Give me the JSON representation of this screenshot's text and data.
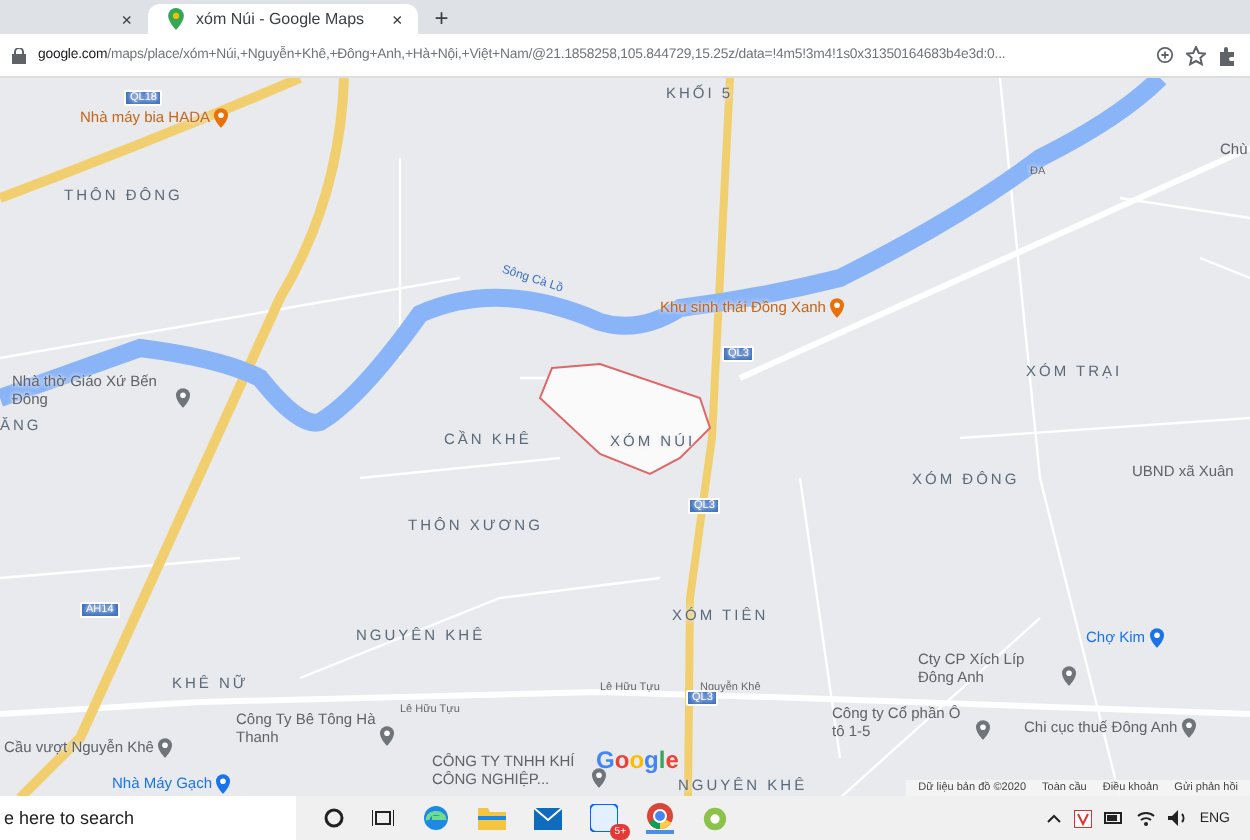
{
  "tabs": [
    {
      "selected": false,
      "close": "×"
    },
    {
      "title": "xóm Núi - Google Maps",
      "selected": true,
      "close": "×"
    }
  ],
  "new_tab": "+",
  "address_bar": {
    "host": "google.com",
    "path": "/maps/place/xóm+Núi,+Nguyễn+Khê,+Đông+Anh,+Hà+Nội,+Việt+Nam/@21.1858258,105.844729,15.25z/data=!4m5!3m4!1s0x31350164683b4e3d:0..."
  },
  "map": {
    "labels": [
      {
        "kind": "shield",
        "text": "QL18"
      },
      {
        "kind": "poi_orange",
        "text": "Nhà máy bia HADA"
      },
      {
        "kind": "locality",
        "text": "KHỐI 5"
      },
      {
        "kind": "locality",
        "text": "THÔN ĐÔNG"
      },
      {
        "kind": "road",
        "text": "ĐA"
      },
      {
        "kind": "place",
        "text": "Chù"
      },
      {
        "kind": "river",
        "text": "Sông Cà Lồ"
      },
      {
        "kind": "poi_orange",
        "text": "Khu sinh thái Đồng Xanh"
      },
      {
        "kind": "shield",
        "text": "QL3"
      },
      {
        "kind": "poi_gray",
        "text": "Nhà thờ Giáo Xứ Bến Đông"
      },
      {
        "kind": "locality",
        "text": "ĂNG"
      },
      {
        "kind": "locality",
        "text": "XÓM TRẠI"
      },
      {
        "kind": "locality",
        "text": "CẦN KHÊ"
      },
      {
        "kind": "locality",
        "text": "XÓM NÚI"
      },
      {
        "kind": "locality",
        "text": "XÓM ĐÔNG"
      },
      {
        "kind": "place",
        "text": "UBND xã Xuân"
      },
      {
        "kind": "shield",
        "text": "QL3"
      },
      {
        "kind": "locality",
        "text": "THÔN XƯƠNG"
      },
      {
        "kind": "shield",
        "text": "AH14"
      },
      {
        "kind": "locality",
        "text": "NGUYÊN KHÊ"
      },
      {
        "kind": "locality",
        "text": "XÓM TIÊN"
      },
      {
        "kind": "poi_blue",
        "text": "Chợ Kim"
      },
      {
        "kind": "locality",
        "text": "KHÊ NỮ"
      },
      {
        "kind": "poi_gray",
        "text": "Cty CP Xích Líp Đông Anh"
      },
      {
        "kind": "road",
        "text": "Lê Hữu Tựu"
      },
      {
        "kind": "road",
        "text": "Lê Hữu Tựu"
      },
      {
        "kind": "road",
        "text": "Nguyễn Khê"
      },
      {
        "kind": "shield",
        "text": "QL3"
      },
      {
        "kind": "poi_gray",
        "text": "Công Ty Bê Tông Hà Thanh"
      },
      {
        "kind": "poi_gray",
        "text": "Công ty Cổ phần Ô tô 1-5"
      },
      {
        "kind": "poi_gray",
        "text": "Cầu vượt Nguyễn Khê"
      },
      {
        "kind": "poi_gray",
        "text": "Chi cục thuế Đông Anh"
      },
      {
        "kind": "poi_blue",
        "text": "Nhà Máy Gạch"
      },
      {
        "kind": "poi_gray",
        "text": "CÔNG TY TNHH KHÍ CÔNG NGHIỆP..."
      },
      {
        "kind": "locality",
        "text": "NGUYÊN KHÊ"
      }
    ],
    "logo": "Google",
    "attribution": [
      "Dữ liệu bản đồ ©2020",
      "Toàn cầu",
      "Điều khoản",
      "Gửi phản hồi"
    ]
  },
  "taskbar": {
    "search_placeholder": "e here to search",
    "zalo_badge": "5+",
    "language": "ENG"
  }
}
